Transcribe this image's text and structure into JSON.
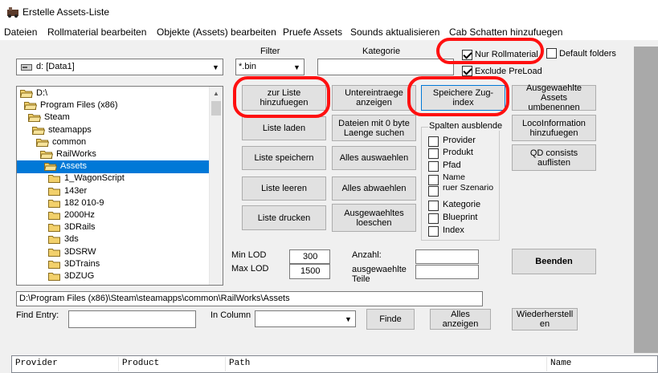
{
  "window": {
    "title": "Erstelle Assets-Liste"
  },
  "menu": [
    "Dateien",
    "Rollmaterial bearbeiten",
    "Objekte (Assets) bearbeiten",
    "Pruefe Assets",
    "Sounds aktualisieren",
    "Cab Schatten hinzufuegen"
  ],
  "drive": {
    "value": "d: [Data1]"
  },
  "filter": {
    "label": "Filter",
    "value": "*.bin"
  },
  "category": {
    "label": "Kategorie",
    "value": ""
  },
  "options": {
    "nur_rollmaterial": {
      "label": "Nur Rollmaterial",
      "checked": true
    },
    "default_folders": {
      "label": "Default folders",
      "checked": false
    },
    "exclude_preload": {
      "label": "Exclude PreLoad",
      "checked": true
    }
  },
  "tree": [
    {
      "name": "D:\\",
      "indent": 0
    },
    {
      "name": "Program Files (x86)",
      "indent": 1
    },
    {
      "name": "Steam",
      "indent": 2
    },
    {
      "name": "steamapps",
      "indent": 3
    },
    {
      "name": "common",
      "indent": 4
    },
    {
      "name": "RailWorks",
      "indent": 5
    },
    {
      "name": "Assets",
      "indent": 6,
      "selected": true
    },
    {
      "name": "1_WagonScript",
      "indent": 7
    },
    {
      "name": "143er",
      "indent": 7
    },
    {
      "name": "182 010-9",
      "indent": 7
    },
    {
      "name": "2000Hz",
      "indent": 7
    },
    {
      "name": "3DRails",
      "indent": 7
    },
    {
      "name": "3ds",
      "indent": 7
    },
    {
      "name": "3DSRW",
      "indent": 7
    },
    {
      "name": "3DTrains",
      "indent": 7
    },
    {
      "name": "3DZUG",
      "indent": 7
    }
  ],
  "buttons": {
    "zur_liste": "zur Liste hinzufuegen",
    "liste_laden": "Liste laden",
    "liste_speichern": "Liste speichern",
    "liste_leeren": "Liste leeren",
    "liste_drucken": "Liste drucken",
    "untereintraege": "Untereintraege anzeigen",
    "dateien_0_byte": "Dateien mit 0 byte Laenge suchen",
    "alles_auswaehlen": "Alles auswaehlen",
    "alles_abwaehlen": "Alles abwaehlen",
    "ausgewaehltes_loeschen": "Ausgewaehltes loeschen",
    "speichere_zug_index": "Speichere Zug-index",
    "umbenennen": "Ausgewaehlte Assets umbenennen",
    "locoinformation": "LocoInformation hinzufuegen",
    "qd_consists": "QD consists auflisten",
    "beenden": "Beenden",
    "finde": "Finde",
    "alles_anzeigen": "Alles anzeigen",
    "wiederherstellen": "Wiederherstellen"
  },
  "spalten": {
    "title": "Spalten ausblende",
    "items": [
      "Provider",
      "Produkt",
      "Pfad",
      "Name",
      "ruer Szenario",
      "Kategorie",
      "Blueprint",
      "Index"
    ]
  },
  "lod": {
    "min_label": "Min LOD",
    "min_value": "300",
    "max_label": "Max LOD",
    "max_value": "1500"
  },
  "counts": {
    "anzahl_label": "Anzahl:",
    "anzahl_value": "",
    "teile_label": "ausgewaehlte Teile",
    "teile_value": ""
  },
  "path": {
    "value": "D:\\Program Files (x86)\\Steam\\steamapps\\common\\RailWorks\\Assets"
  },
  "find": {
    "label": "Find Entry:",
    "value": "",
    "column_label": "In Column",
    "column_value": ""
  },
  "list_columns": [
    "Provider",
    "Product",
    "Path",
    "Name"
  ],
  "colors": {
    "annotation": "#ff1010",
    "selection": "#0078d7",
    "folder": "#f2d06b"
  }
}
